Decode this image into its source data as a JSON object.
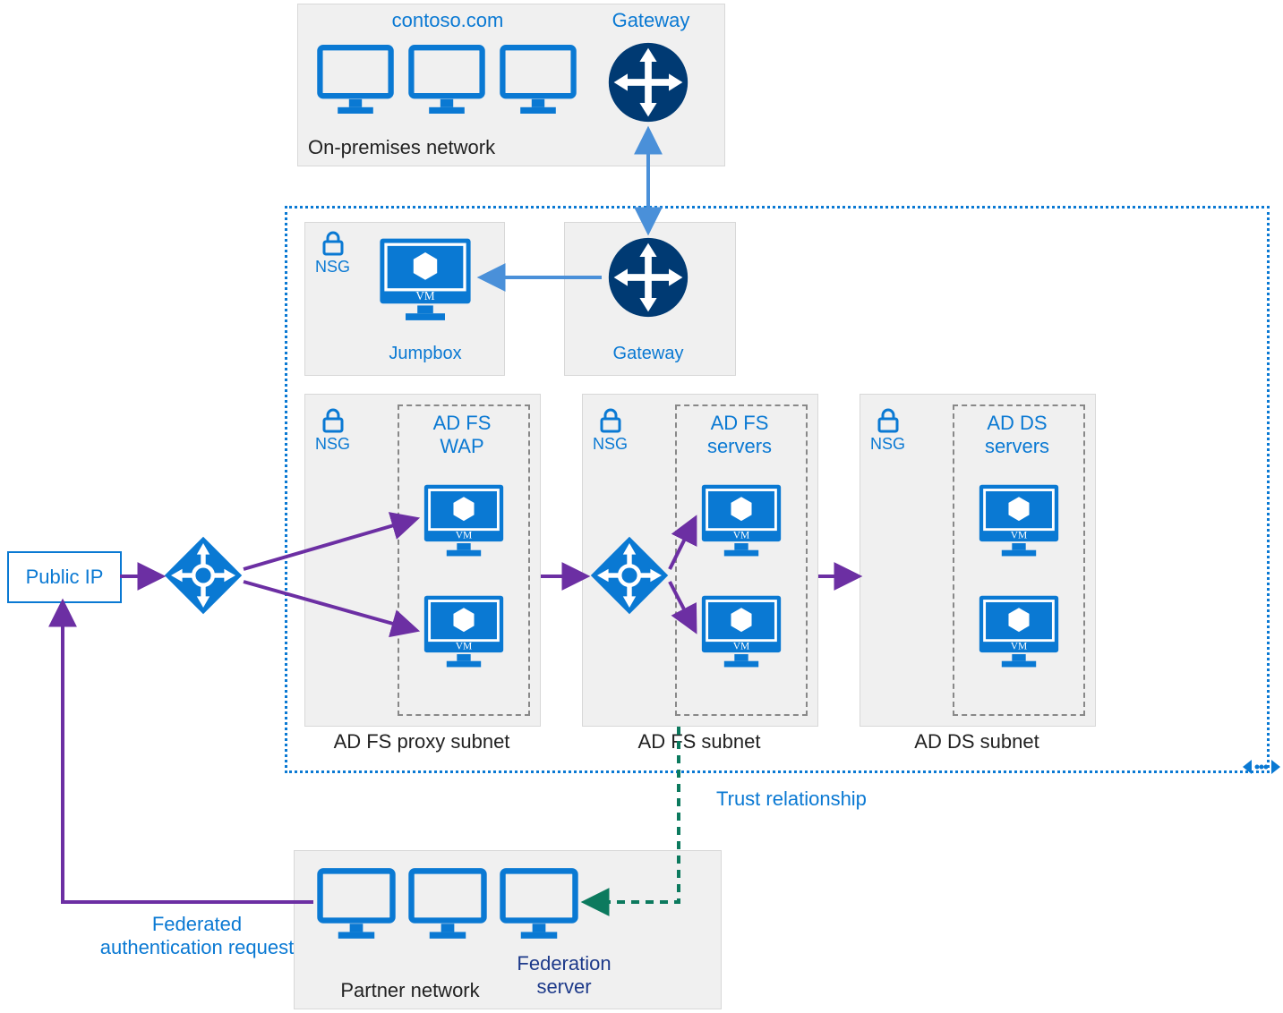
{
  "onprem": {
    "title": "On-premises network",
    "domain": "contoso.com",
    "gateway": "Gateway"
  },
  "azure": {
    "jumpbox": {
      "nsg": "NSG",
      "label": "Jumpbox"
    },
    "gateway": "Gateway",
    "subnets": {
      "wap": {
        "nsg": "NSG",
        "title": "AD FS\nWAP",
        "caption": "AD FS proxy subnet"
      },
      "adfs": {
        "nsg": "NSG",
        "title": "AD FS\nservers",
        "caption": "AD FS subnet"
      },
      "adds": {
        "nsg": "NSG",
        "title": "AD DS\nservers",
        "caption": "AD DS subnet"
      }
    }
  },
  "public_ip": "Public IP",
  "partner": {
    "caption": "Partner network",
    "fed_server": "Federation\nserver"
  },
  "annotations": {
    "trust": "Trust relationship",
    "fed_request": "Federated\nauthentication request"
  },
  "colors": {
    "azure_blue": "#0a79d3",
    "navy": "#003a73",
    "purple": "#6c2fa3",
    "teal": "#0c7a5e"
  }
}
